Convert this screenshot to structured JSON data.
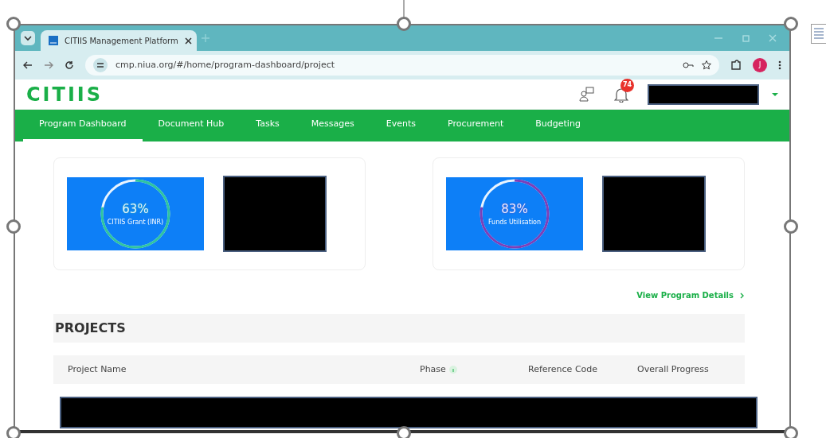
{
  "browser": {
    "tabs": [
      {
        "title": "CITIIS Management Platform",
        "selected": true
      }
    ],
    "url": "cmp.niua.org/#/home/program-dashboard/project",
    "profile_initial": "J"
  },
  "app": {
    "logo": "CITIIS",
    "notification_count": "74",
    "nav": [
      {
        "label": "Program Dashboard",
        "selected": true
      },
      {
        "label": "Document Hub",
        "selected": false
      },
      {
        "label": "Tasks",
        "selected": false
      },
      {
        "label": "Messages",
        "selected": false
      },
      {
        "label": "Events",
        "selected": false
      },
      {
        "label": "Procurement",
        "selected": false
      },
      {
        "label": "Budgeting",
        "selected": false
      }
    ],
    "stat_cards": [
      {
        "value": "63%",
        "label": "CITIIS Grant (INR)",
        "color": "#2ec4a0"
      },
      {
        "value": "83%",
        "label": "Funds Utilisation",
        "color": "#7b3fb8"
      }
    ],
    "view_details_link": "View Program Details",
    "projects": {
      "title": "PROJECTS",
      "columns": [
        {
          "label": "Project Name",
          "info": false
        },
        {
          "label": "Phase",
          "info": true
        },
        {
          "label": "Reference Code",
          "info": false
        },
        {
          "label": "Overall Progress",
          "info": false
        }
      ]
    }
  }
}
